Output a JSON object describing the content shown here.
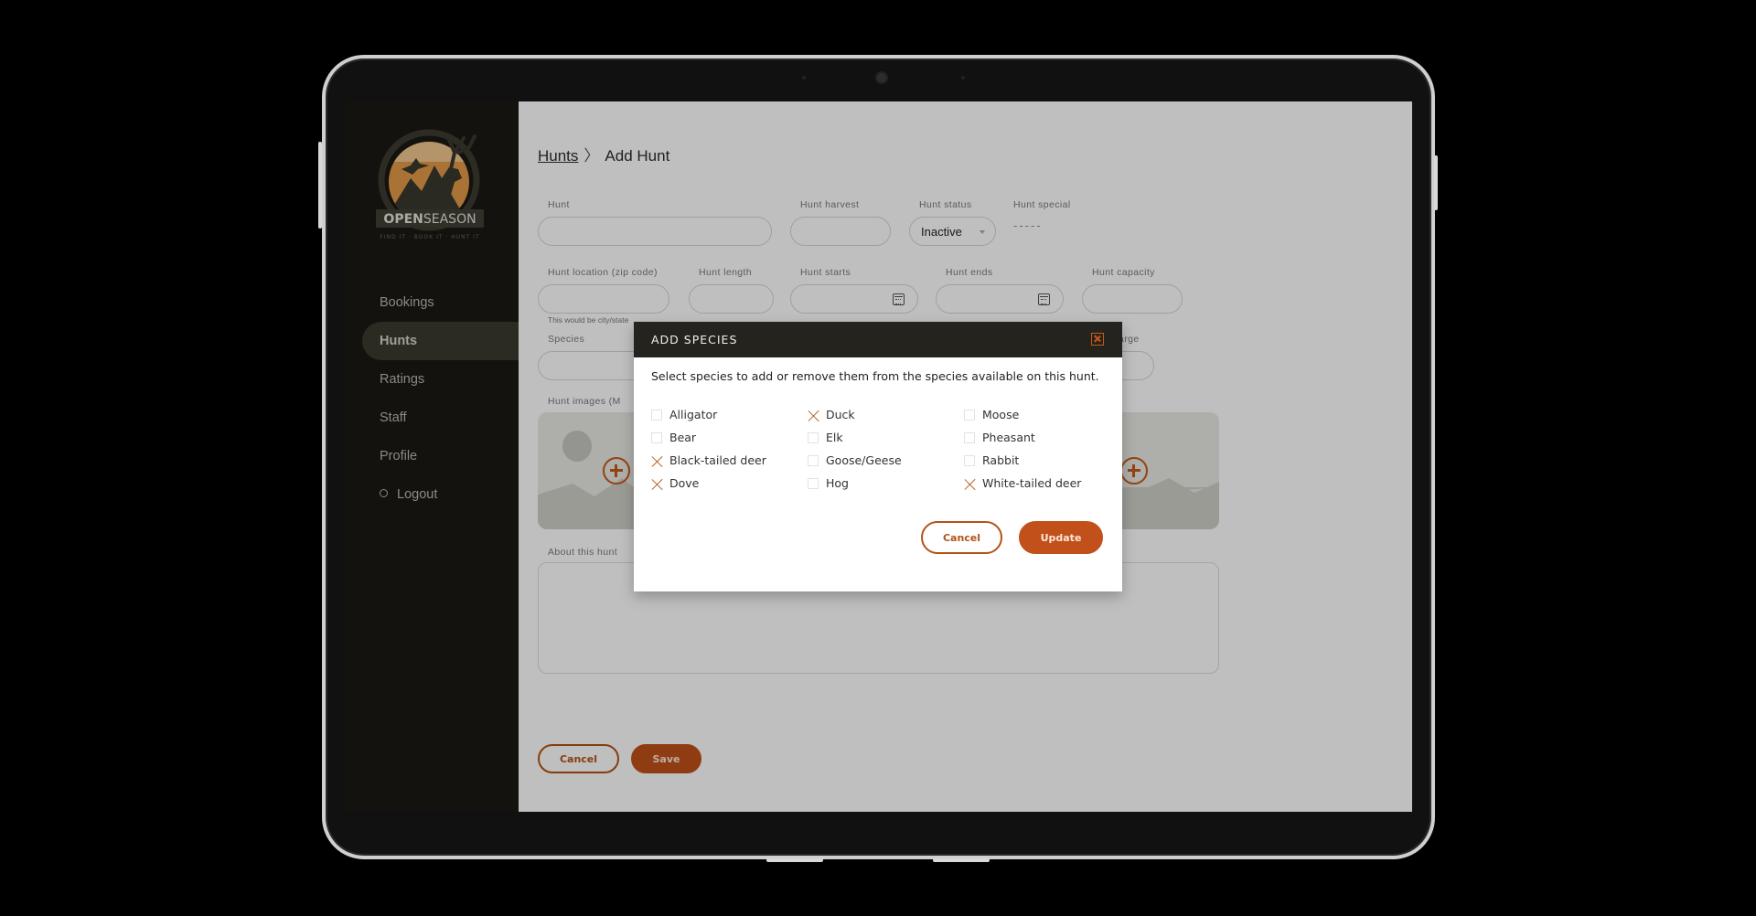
{
  "brand": {
    "name_bold": "OPEN",
    "name_light": "SEASON",
    "tagline": "FIND IT · BOOK IT · HUNT IT",
    "accent": "#c1501a",
    "sidebar_bg": "#1a1913"
  },
  "sidebar": {
    "items": [
      {
        "label": "Bookings",
        "active": false
      },
      {
        "label": "Hunts",
        "active": true
      },
      {
        "label": "Ratings",
        "active": false
      },
      {
        "label": "Staff",
        "active": false
      },
      {
        "label": "Profile",
        "active": false
      }
    ],
    "logout_label": "Logout"
  },
  "breadcrumb": {
    "parent": "Hunts",
    "separator": "〉",
    "current": "Add Hunt"
  },
  "form": {
    "hunt_label": "Hunt",
    "hunt_value": "",
    "harvest_label": "Hunt harvest",
    "harvest_value": "",
    "status_label": "Hunt status",
    "status_value": "Inactive",
    "special_label": "Hunt special",
    "special_value": "-----",
    "location_label": "Hunt location (zip code)",
    "location_hint": "This would be city/state",
    "length_label": "Hunt length",
    "starts_label": "Hunt starts",
    "ends_label": "Hunt ends",
    "capacity_label": "Hunt capacity",
    "species_label": "Species",
    "charge_label_partial": "arge",
    "images_label": "Hunt images (M",
    "about_label": "About this hunt",
    "cancel_label": "Cancel",
    "save_label": "Save"
  },
  "modal": {
    "title": "ADD SPECIES",
    "description": "Select species to add or remove them from the species available on this hunt.",
    "species": [
      {
        "name": "Alligator",
        "checked": false
      },
      {
        "name": "Bear",
        "checked": false
      },
      {
        "name": "Black-tailed deer",
        "checked": true
      },
      {
        "name": "Dove",
        "checked": true
      },
      {
        "name": "Duck",
        "checked": true
      },
      {
        "name": "Elk",
        "checked": false
      },
      {
        "name": "Goose/Geese",
        "checked": false
      },
      {
        "name": "Hog",
        "checked": false
      },
      {
        "name": "Moose",
        "checked": false
      },
      {
        "name": "Pheasant",
        "checked": false
      },
      {
        "name": "Rabbit",
        "checked": false
      },
      {
        "name": "White-tailed deer",
        "checked": true
      }
    ],
    "cancel_label": "Cancel",
    "update_label": "Update"
  }
}
